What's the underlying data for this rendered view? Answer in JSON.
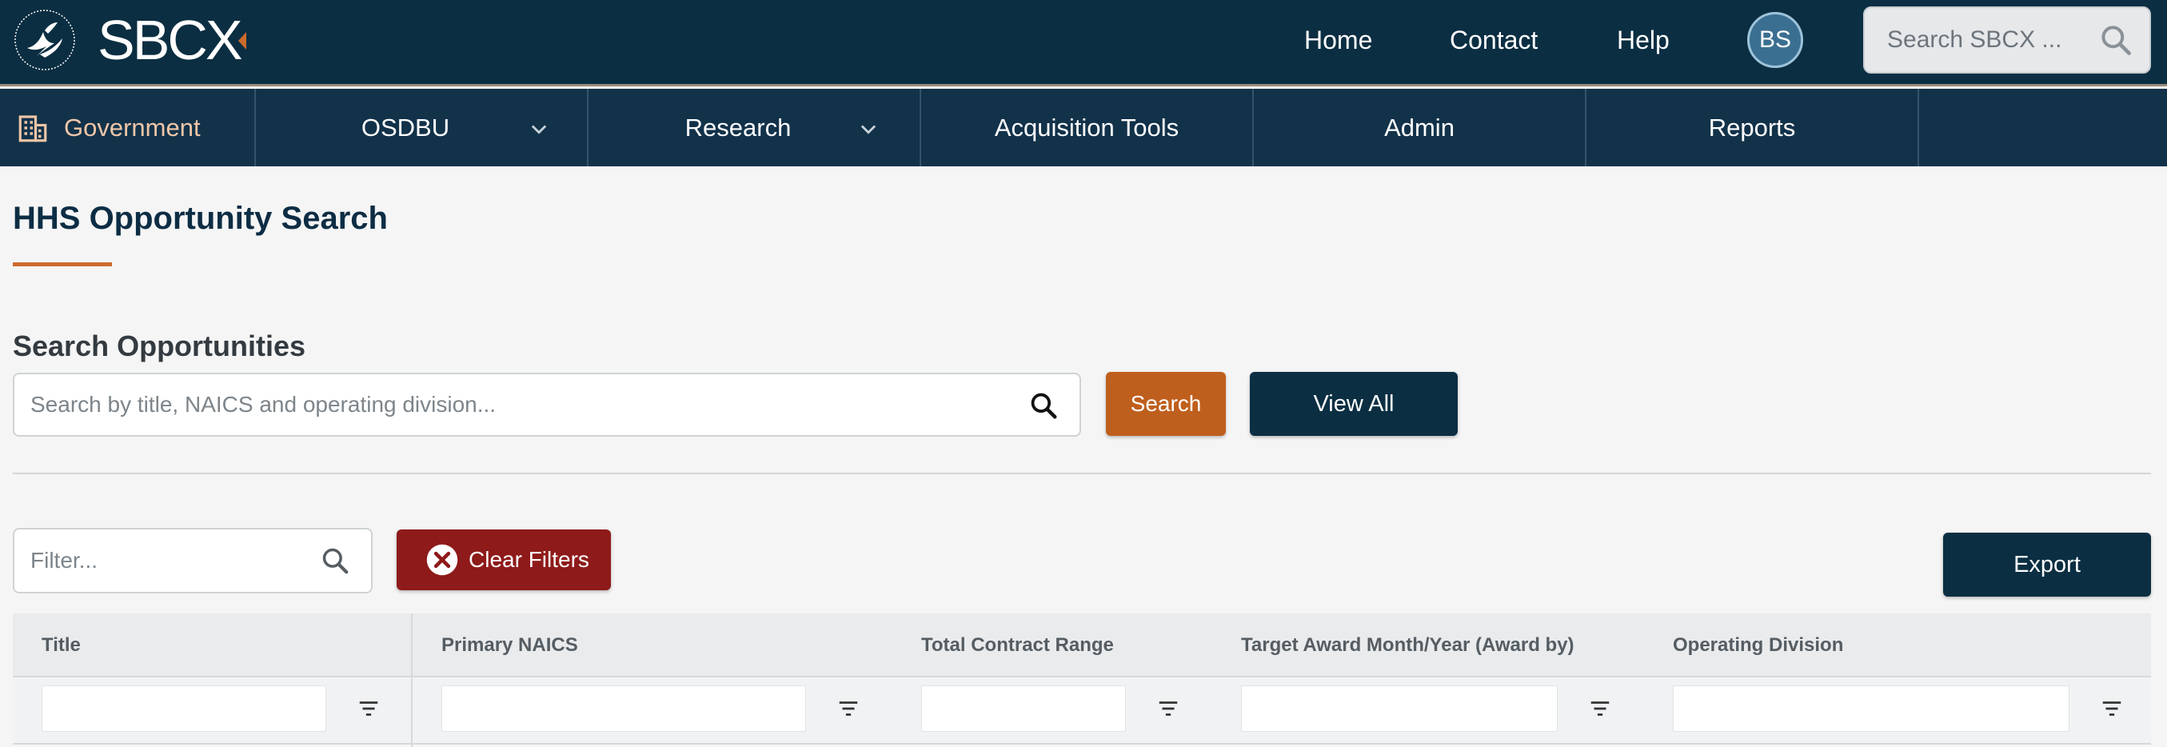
{
  "brand": {
    "name": "SBCX",
    "accent_color": "#cc6a2b",
    "primary_color": "#0b2e42"
  },
  "topnav": {
    "links": [
      "Home",
      "Contact",
      "Help"
    ],
    "avatar_initials": "BS",
    "search_placeholder": "Search SBCX ..."
  },
  "mainnav": {
    "items": [
      {
        "label": "Government",
        "icon": "building-icon"
      },
      {
        "label": "OSDBU",
        "dropdown": true
      },
      {
        "label": "Research",
        "dropdown": true
      },
      {
        "label": "Acquisition Tools"
      },
      {
        "label": "Admin"
      },
      {
        "label": "Reports"
      }
    ]
  },
  "page": {
    "title": "HHS Opportunity Search",
    "section_title": "Search Opportunities",
    "search_placeholder": "Search by title, NAICS and operating division...",
    "search_button": "Search",
    "view_all_button": "View All",
    "filter_placeholder": "Filter...",
    "clear_filters_button": "Clear Filters",
    "export_button": "Export"
  },
  "table": {
    "columns": [
      "Title",
      "Primary NAICS",
      "Total Contract Range",
      "Target Award Month/Year (Award by)",
      "Operating Division"
    ]
  }
}
